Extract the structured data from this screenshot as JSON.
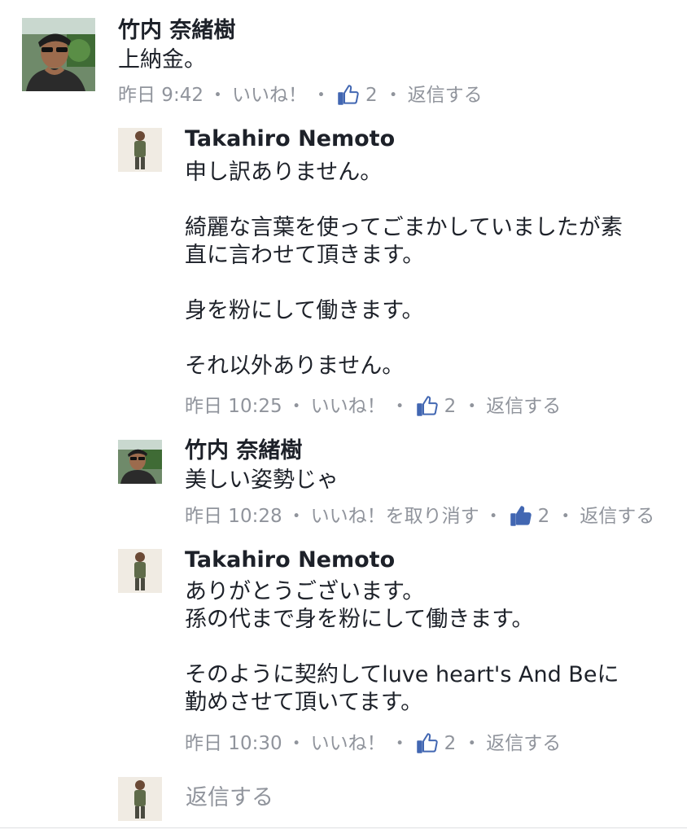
{
  "comments": [
    {
      "author": "竹内 奈緒樹",
      "text": "上納金。",
      "time": "昨日 9:42",
      "like_action": "いいね！",
      "likes": "2",
      "reply_action": "返信する",
      "avatar": "sunglasses-man-avatar"
    },
    {
      "author": "Takahiro Nemoto",
      "text": "申し訳ありません。\n\n綺麗な言葉を使ってごまかしていましたが素\n直に言わせて頂きます。\n\n身を粉にして働きます。\n\nそれ以外ありません。",
      "time": "昨日 10:25",
      "like_action": "いいね！",
      "likes": "2",
      "reply_action": "返信する",
      "avatar": "standing-man-avatar"
    },
    {
      "author": "竹内 奈緒樹",
      "text": "美しい姿勢じゃ",
      "time": "昨日 10:28",
      "like_action": "いいね！を取り消す",
      "likes": "2",
      "reply_action": "返信する",
      "avatar": "sunglasses-man-avatar",
      "liked": true
    },
    {
      "author": "Takahiro Nemoto",
      "text": "ありがとうございます。\n孫の代まで身を粉にして働きます。\n\nそのように契約してluve heart's And Beに\n勤めさせて頂いてます。",
      "time": "昨日 10:30",
      "like_action": "いいね！",
      "likes": "2",
      "reply_action": "返信する",
      "avatar": "standing-man-avatar"
    }
  ],
  "composer": {
    "placeholder": "返信する",
    "avatar": "standing-man-avatar"
  },
  "separator": "・",
  "colors": {
    "text": "#1d2129",
    "meta": "#90949c",
    "like_blue": "#4267b2",
    "background": "#ffffff"
  },
  "icons": {
    "like": "thumbs-up-icon",
    "liked": "thumbs-up-filled-icon"
  }
}
